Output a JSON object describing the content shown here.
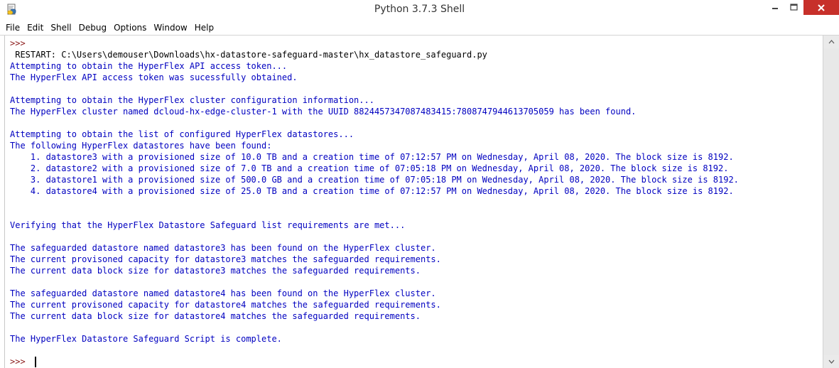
{
  "window": {
    "title": "Python 3.7.3 Shell",
    "icons": {
      "app": "python-idle-icon",
      "minimize": "minimize-icon",
      "maximize": "maximize-icon",
      "close": "close-icon"
    },
    "colors": {
      "close_button": "#c7302a",
      "output_text": "#0000c0",
      "prompt": "#8b1a1a"
    }
  },
  "menubar": {
    "items": [
      "File",
      "Edit",
      "Shell",
      "Debug",
      "Options",
      "Window",
      "Help"
    ]
  },
  "shell": {
    "lines": [
      ">>> ",
      " RESTART: C:\\Users\\demouser\\Downloads\\hx-datastore-safeguard-master\\hx_datastore_safeguard.py",
      "Attempting to obtain the HyperFlex API access token...",
      "The HyperFlex API access token was sucessfully obtained.",
      "",
      "Attempting to obtain the HyperFlex cluster configuration information...",
      "The HyperFlex cluster named dcloud-hx-edge-cluster-1 with the UUID 8824457347087483415:7808747944613705059 has been found.",
      "",
      "Attempting to obtain the list of configured HyperFlex datastores...",
      "The following HyperFlex datastores have been found:",
      "    1. datastore3 with a provisioned size of 10.0 TB and a creation time of 07:12:57 PM on Wednesday, April 08, 2020. The block size is 8192.",
      "    2. datastore2 with a provisioned size of 7.0 TB and a creation time of 07:05:18 PM on Wednesday, April 08, 2020. The block size is 8192.",
      "    3. datastore1 with a provisioned size of 500.0 GB and a creation time of 07:05:18 PM on Wednesday, April 08, 2020. The block size is 8192.",
      "    4. datastore4 with a provisioned size of 25.0 TB and a creation time of 07:12:57 PM on Wednesday, April 08, 2020. The block size is 8192.",
      "",
      "",
      "Verifying that the HyperFlex Datastore Safeguard list requirements are met...",
      "",
      "The safeguarded datastore named datastore3 has been found on the HyperFlex cluster.",
      "The current provisoned capacity for datastore3 matches the safeguarded requirements.",
      "The current data block size for datastore3 matches the safeguarded requirements.",
      "",
      "The safeguarded datastore named datastore4 has been found on the HyperFlex cluster.",
      "The current provisoned capacity for datastore4 matches the safeguarded requirements.",
      "The current data block size for datastore4 matches the safeguarded requirements.",
      "",
      "The HyperFlex Datastore Safeguard Script is complete.",
      ""
    ],
    "prompt": ">>> "
  }
}
